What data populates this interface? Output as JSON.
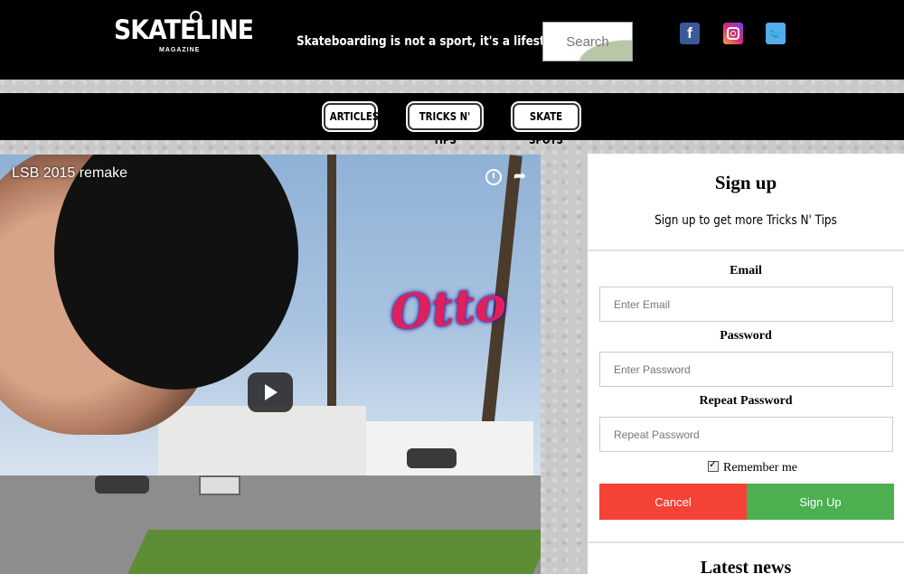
{
  "header": {
    "logo_text": "SKATELINE",
    "logo_sub": "MAGAZINE",
    "tagline": "Skateboarding is not a sport, it's a lifestyle",
    "search_placeholder": "Search",
    "social": [
      "facebook-icon",
      "instagram-icon",
      "twitter-icon"
    ]
  },
  "nav": {
    "items": [
      {
        "label": "ARTICLES"
      },
      {
        "label": "TRICKS N' TIPS"
      },
      {
        "label": "SKATE SPOTS"
      }
    ]
  },
  "video": {
    "title": "LSB 2015 remake",
    "overlay_text": "Otto",
    "icons": [
      "clock-icon",
      "share-icon",
      "play-icon"
    ]
  },
  "signup": {
    "title": "Sign up",
    "subtitle": "Sign up to get more Tricks N' Tips",
    "email_label": "Email",
    "email_placeholder": "Enter Email",
    "password_label": "Password",
    "password_placeholder": "Enter Password",
    "repeat_label": "Repeat Password",
    "repeat_placeholder": "Repeat Password",
    "remember_label": "Remember me",
    "remember_checked": true,
    "cancel_label": "Cancel",
    "signup_label": "Sign Up"
  },
  "latest_news": {
    "title": "Latest news"
  },
  "colors": {
    "header_bg": "#000000",
    "cancel": "#f44336",
    "signup": "#4caf50",
    "facebook": "#3b5998",
    "twitter": "#55acee"
  }
}
